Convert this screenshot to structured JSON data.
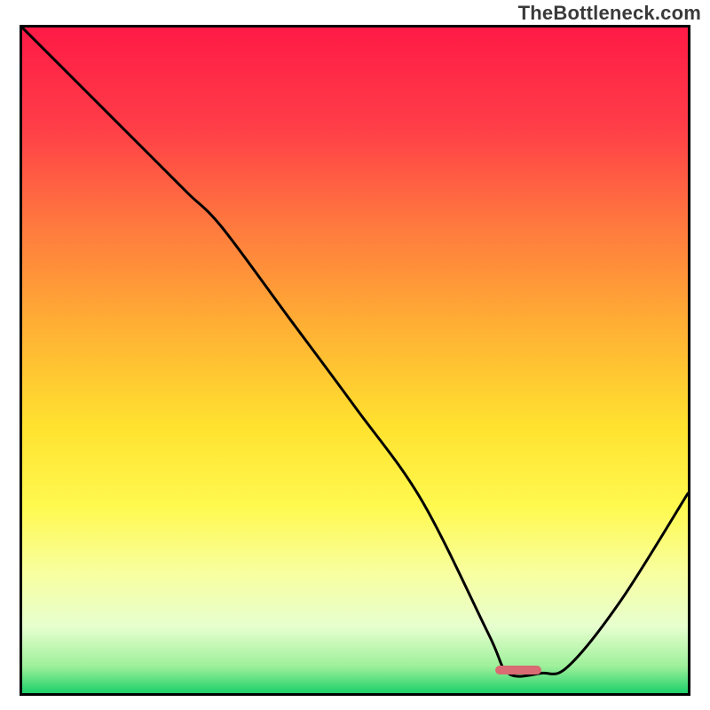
{
  "watermark": "TheBottleneck.com",
  "gradient": {
    "stops": [
      {
        "offset": 0.0,
        "color": "#ff1a46"
      },
      {
        "offset": 0.15,
        "color": "#ff3e48"
      },
      {
        "offset": 0.3,
        "color": "#ff7a3e"
      },
      {
        "offset": 0.45,
        "color": "#ffb034"
      },
      {
        "offset": 0.6,
        "color": "#ffe22f"
      },
      {
        "offset": 0.72,
        "color": "#fff94f"
      },
      {
        "offset": 0.82,
        "color": "#f8ffa0"
      },
      {
        "offset": 0.9,
        "color": "#e7ffcf"
      },
      {
        "offset": 0.96,
        "color": "#9df09a"
      },
      {
        "offset": 1.0,
        "color": "#1dd06a"
      }
    ]
  },
  "marker": {
    "x_frac": 0.745,
    "width_frac": 0.07,
    "y_frac": 0.965
  },
  "chart_data": {
    "type": "line",
    "title": "",
    "xlabel": "",
    "ylabel": "",
    "xlim": [
      0,
      1
    ],
    "ylim": [
      0,
      1
    ],
    "x": [
      0.0,
      0.1,
      0.2,
      0.25,
      0.3,
      0.4,
      0.5,
      0.6,
      0.7,
      0.73,
      0.78,
      0.82,
      0.9,
      1.0
    ],
    "values": [
      1.0,
      0.9,
      0.8,
      0.75,
      0.7,
      0.565,
      0.43,
      0.29,
      0.09,
      0.03,
      0.03,
      0.04,
      0.14,
      0.3
    ],
    "series": [
      {
        "name": "bottleneck-curve",
        "color": "#000000"
      }
    ]
  }
}
